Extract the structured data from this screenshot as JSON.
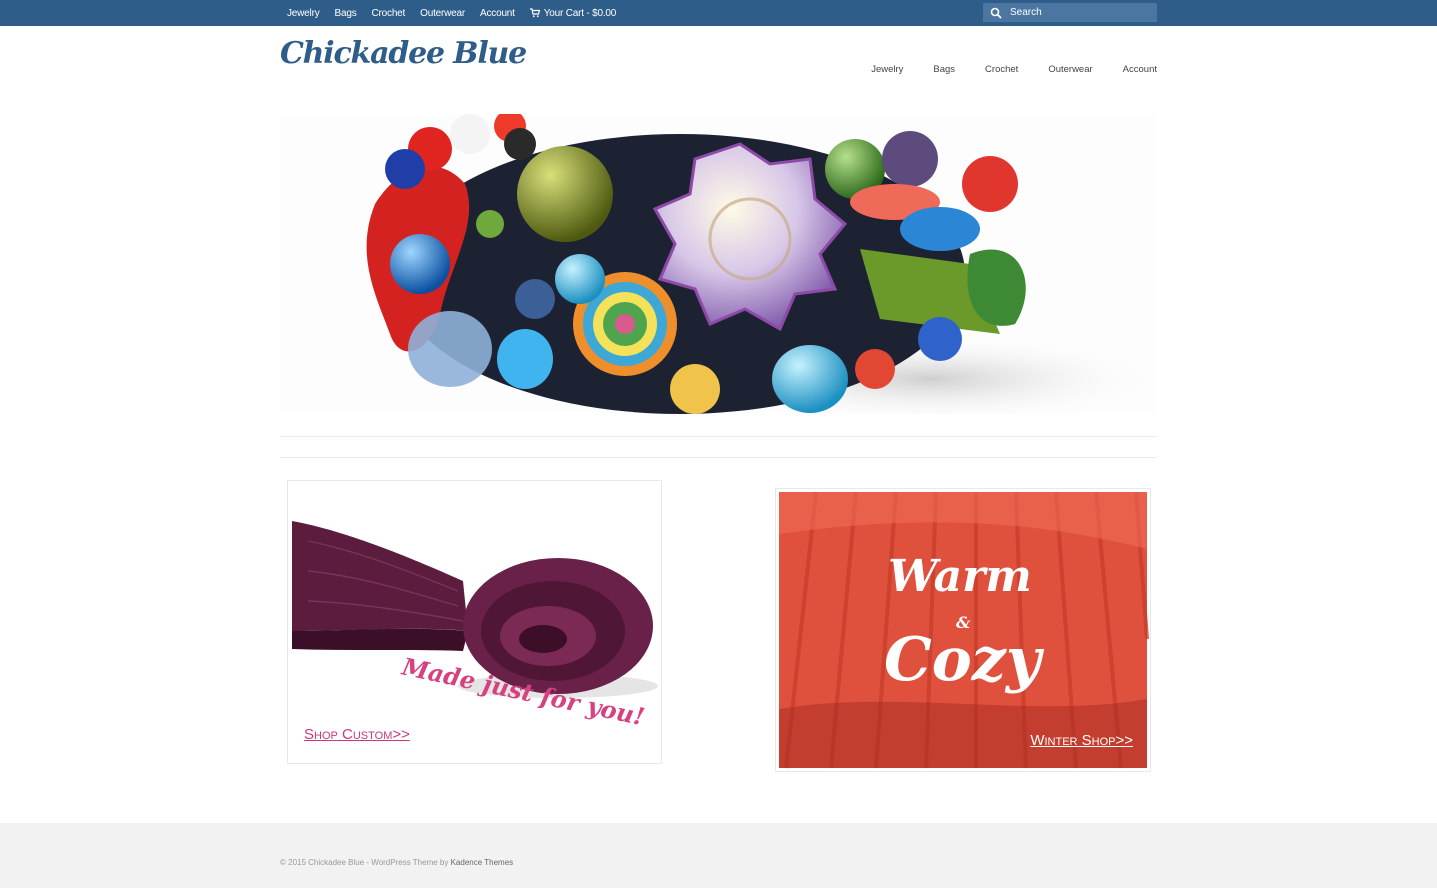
{
  "topbar": {
    "nav": [
      "Jewelry",
      "Bags",
      "Crochet",
      "Outerwear",
      "Account"
    ],
    "cart_label": "Your Cart - $0.00",
    "search_placeholder": "Search"
  },
  "header": {
    "logo": "Chickadee Blue",
    "nav": [
      "Jewelry",
      "Bags",
      "Crochet",
      "Outerwear",
      "Account"
    ]
  },
  "promos": {
    "left": {
      "tagline": "Made just for you!",
      "link": "Shop Custom>>"
    },
    "right": {
      "title_1": "Warm",
      "amp": "&",
      "title_2": "Cozy",
      "link": "Winter Shop>>"
    }
  },
  "footer": {
    "copyright": "© 2015 Chickadee Blue - WordPress Theme by ",
    "credit_link": "Kadence Themes"
  },
  "colors": {
    "topbar": "#2f5d8a",
    "search_bg": "#4b76a1",
    "logo": "#2f5d8a",
    "pink": "#d6417f",
    "sweater": "#e5523f",
    "footer_bg": "#f2f2f2"
  }
}
